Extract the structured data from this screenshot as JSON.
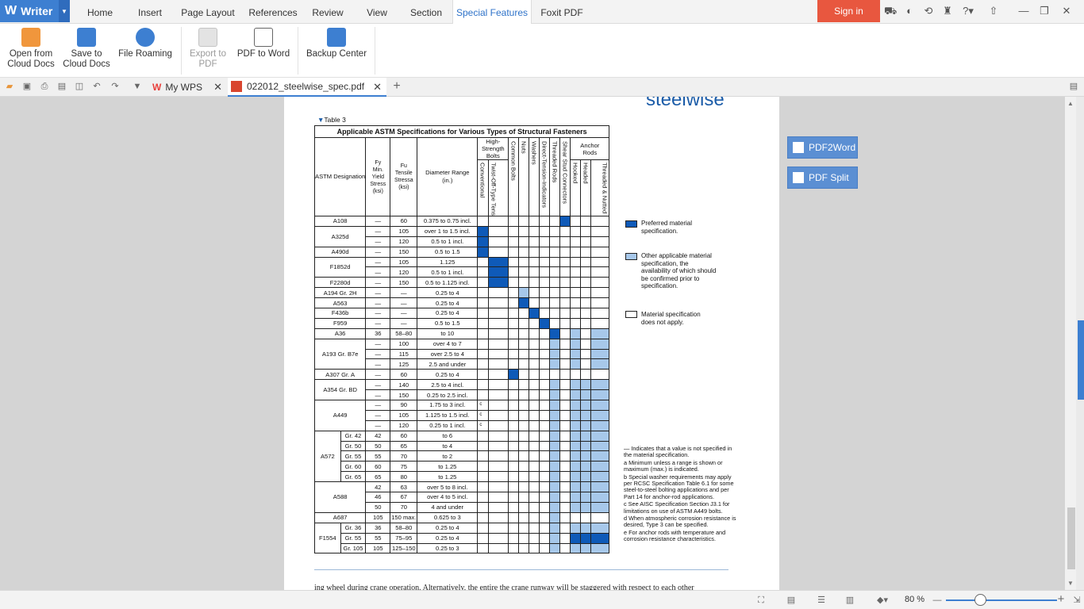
{
  "app": {
    "name": "Writer",
    "logo": "W"
  },
  "menu_tabs": [
    "Home",
    "Insert",
    "Page Layout",
    "References",
    "Review",
    "View",
    "Section",
    "Special Features",
    "Foxit PDF"
  ],
  "active_menu": "Special Features",
  "signin": "Sign in",
  "title_icons": [
    "cart-icon",
    "skin-icon",
    "share-icon",
    "shirt-icon",
    "help-icon",
    "upload-icon",
    "minimize-icon",
    "restore-icon",
    "close-icon"
  ],
  "ribbon": [
    {
      "label1": "Open from",
      "label2": "Cloud Docs",
      "icon": "folder-cloud-icon"
    },
    {
      "label1": "Save to",
      "label2": "Cloud Docs",
      "icon": "save-cloud-icon"
    },
    {
      "label1": "File Roaming",
      "label2": "",
      "icon": "cloud-roaming-icon"
    },
    {
      "label1": "Export to",
      "label2": "PDF",
      "icon": "export-pdf-icon",
      "disabled": true
    },
    {
      "label1": "PDF to Word",
      "label2": "",
      "icon": "pdf-to-word-icon"
    },
    {
      "label1": "Backup Center",
      "label2": "",
      "icon": "backup-icon"
    }
  ],
  "tabs": [
    {
      "label": "My WPS"
    },
    {
      "label": "022012_steelwise_spec.pdf"
    }
  ],
  "float_buttons": [
    "PDF2Word",
    "PDF Split"
  ],
  "zoom": "80 %",
  "zoom_level": 0.31,
  "document": {
    "brand": "steelwise",
    "table_label": "Table 3",
    "table_title": "Applicable ASTM Specifications for Various Types of Structural Fasteners",
    "headers": {
      "astm": "ASTM Designation",
      "fy1": "Fy",
      "fy2": "Min.",
      "fy3": "Yield",
      "fy4": "Stress",
      "fy5": "(ksi)",
      "fu1": "Fu",
      "fu2": "Tensile",
      "fu3": "Stressa",
      "fu4": "(ksi)",
      "dia1": "Diameter Range",
      "dia2": "(in.)",
      "hs1": "High-",
      "hs2": "Strength",
      "hs3": "Bolts",
      "ar1": "Anchor",
      "ar2": "Rods",
      "conv": "Conventional",
      "twist": "Twist-Off-Type Tension-Control",
      "common": "Common Bolts",
      "nuts": "Nuts",
      "washers": "Washers",
      "dti": "Direct-Tension-Indicators",
      "threaded": "Threaded Rods",
      "shear": "Shear Stud Connectors",
      "hooked": "Hooked",
      "headed": "Headed",
      "tn": "Threaded & Nutted"
    },
    "rows": [
      {
        "g": "A108",
        "gs": 1,
        "fy": "—",
        "fu": "60",
        "d": "0.375 to 0.75 incl.",
        "c": "0000000D000"
      },
      {
        "g": "A325d",
        "gs": 2,
        "fy": "—",
        "fu": "105",
        "d": "over 1 to 1.5 incl.",
        "c": "D0000000000"
      },
      {
        "fy": "—",
        "fu": "120",
        "d": "0.5 to 1 incl.",
        "c": "D0000000000"
      },
      {
        "g": "A490d",
        "gs": 1,
        "fy": "—",
        "fu": "150",
        "d": "0.5 to 1.5",
        "c": "D0000000000"
      },
      {
        "g": "F1852d",
        "gs": 2,
        "fy": "—",
        "fu": "105",
        "d": "1.125",
        "c": "0D000000000"
      },
      {
        "fy": "—",
        "fu": "120",
        "d": "0.5 to 1 incl.",
        "c": "0D000000000"
      },
      {
        "g": "F2280d",
        "gs": 1,
        "fy": "—",
        "fu": "150",
        "d": "0.5 to 1.125 incl.",
        "c": "0D000000000"
      },
      {
        "g": "A194 Gr. 2H",
        "gs": 1,
        "fy": "—",
        "fu": "—",
        "d": "0.25 to 4",
        "c": "000L0000000"
      },
      {
        "g": "A563",
        "gs": 1,
        "fy": "—",
        "fu": "—",
        "d": "0.25 to 4",
        "c": "000D0000000"
      },
      {
        "g": "F436b",
        "gs": 1,
        "fy": "—",
        "fu": "—",
        "d": "0.25 to 4",
        "c": "0000D000000"
      },
      {
        "g": "F959",
        "gs": 1,
        "fy": "—",
        "fu": "—",
        "d": "0.5 to 1.5",
        "c": "00000D00000"
      },
      {
        "g": "A36",
        "gs": 1,
        "fy": "36",
        "fu": "58–80",
        "d": "to 10",
        "c": "000000D0L0L"
      },
      {
        "g": "A193 Gr. B7e",
        "gs": 3,
        "fy": "—",
        "fu": "100",
        "d": "over 4 to 7",
        "c": "000000L0L0L"
      },
      {
        "fy": "—",
        "fu": "115",
        "d": "over 2.5 to 4",
        "c": "000000L0L0L"
      },
      {
        "fy": "—",
        "fu": "125",
        "d": "2.5 and under",
        "c": "000000L0L0L"
      },
      {
        "g": "A307 Gr. A",
        "gs": 1,
        "fy": "—",
        "fu": "60",
        "d": "0.25 to 4",
        "c": "00D00000000"
      },
      {
        "g": "A354 Gr. BD",
        "gs": 2,
        "fy": "—",
        "fu": "140",
        "d": "2.5 to 4 incl.",
        "c": "000000L0LLL"
      },
      {
        "fy": "—",
        "fu": "150",
        "d": "0.25 to 2.5 incl.",
        "c": "000000L0LLL"
      },
      {
        "g": "A449",
        "gs": 3,
        "fy": "—",
        "fu": "90",
        "d": "1.75 to 3 incl.",
        "c": "c00000L0LLL"
      },
      {
        "fy": "—",
        "fu": "105",
        "d": "1.125 to 1.5 incl.",
        "c": "c00000L0LLL"
      },
      {
        "fy": "—",
        "fu": "120",
        "d": "0.25 to 1 incl.",
        "c": "c00000L0LLL"
      },
      {
        "g": "A572",
        "gs": 5,
        "sub": "Gr. 42",
        "fy": "42",
        "fu": "60",
        "d": "to 6",
        "c": "000000L0LLL"
      },
      {
        "sub": "Gr. 50",
        "fy": "50",
        "fu": "65",
        "d": "to 4",
        "c": "000000L0LLL"
      },
      {
        "sub": "Gr. 55",
        "fy": "55",
        "fu": "70",
        "d": "to 2",
        "c": "000000L0LLL"
      },
      {
        "sub": "Gr. 60",
        "fy": "60",
        "fu": "75",
        "d": "to 1.25",
        "c": "000000L0LLL"
      },
      {
        "sub": "Gr. 65",
        "fy": "65",
        "fu": "80",
        "d": "to 1.25",
        "c": "000000L0LLL"
      },
      {
        "g": "A588",
        "gs": 3,
        "fy": "42",
        "fu": "63",
        "d": "over 5 to 8 incl.",
        "c": "000000L0LLL"
      },
      {
        "fy": "46",
        "fu": "67",
        "d": "over 4 to 5 incl.",
        "c": "000000L0LLL"
      },
      {
        "fy": "50",
        "fu": "70",
        "d": "4 and under",
        "c": "000000L0LLL"
      },
      {
        "g": "A687",
        "gs": 1,
        "fy": "105",
        "fu": "150 max.",
        "d": "0.625 to 3",
        "c": "000000L0000"
      },
      {
        "g": "F1554",
        "gs": 3,
        "sub": "Gr. 36",
        "fy": "36",
        "fu": "58–80",
        "d": "0.25 to 4",
        "c": "000000L0LLL"
      },
      {
        "sub": "Gr. 55",
        "fy": "55",
        "fu": "75–95",
        "d": "0.25 to 4",
        "c": "000000L0DDD"
      },
      {
        "sub": "Gr. 105",
        "fy": "105",
        "fu": "125–150",
        "d": "0.25 to 3",
        "c": "000000L0LLL"
      }
    ],
    "legend": [
      {
        "type": "D",
        "l1": "Preferred material",
        "l2": "specification."
      },
      {
        "type": "L",
        "l1": "Other applicable material",
        "l2": "specification, the",
        "l3": "availability of which should",
        "l4": "be confirmed prior to",
        "l5": "specification."
      },
      {
        "type": "0",
        "l1": "Material specification",
        "l2": "does not apply."
      }
    ],
    "notes": [
      "— Indicates that a value is not specified in the material specification.",
      "a Minimum unless a range is shown or maximum (max.) is indicated.",
      "b Special washer requirements may apply per RCSC Specification Table 6.1 for some steel-to-steel bolting applications and per Part 14 for anchor-rod applications.",
      "c See AISC Specification Section J3.1 for limitations on use of ASTM A449 bolts.",
      "d When atmospheric corrosion resistance is desired, Type 3 can be specified.",
      "e For anchor rods with temperature and corrosion resistance characteristics."
    ],
    "body_text": "ing wheel during crane operation. Alternatively, the entire     the crane runway will be staggered with respect to each other"
  },
  "colors": {
    "accent": "#3d7fd1",
    "dark_cell": "#0f5ab8",
    "light_cell": "#a7c8ea",
    "signin": "#e8573f"
  }
}
